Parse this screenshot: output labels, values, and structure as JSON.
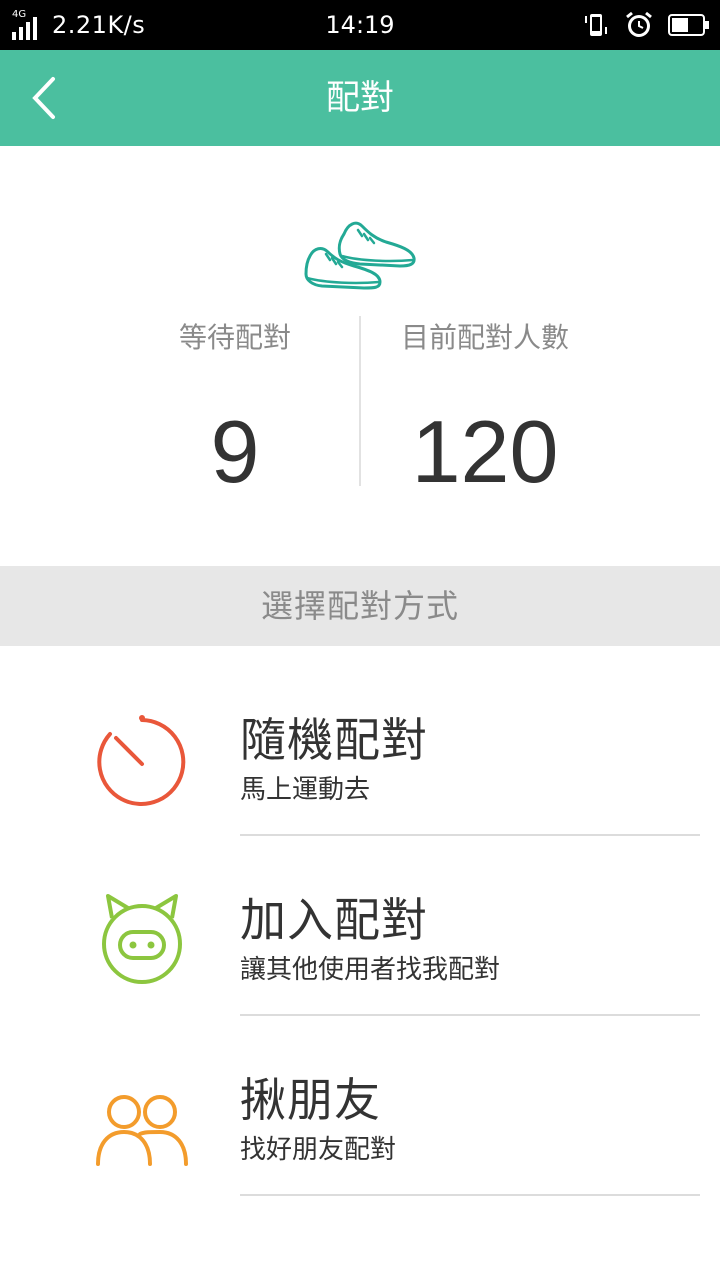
{
  "status_bar": {
    "network_type": "4G",
    "speed": "2.21K/s",
    "time": "14:19",
    "icons": [
      "vibrate-icon",
      "alarm-icon",
      "battery-icon"
    ]
  },
  "header": {
    "title": "配對",
    "back_icon": "chevron-left-icon",
    "background_color": "#4bbf9f"
  },
  "stats": {
    "icon": "shoes-icon",
    "waiting": {
      "label": "等待配對",
      "value": "9"
    },
    "current": {
      "label": "目前配對人數",
      "value": "120"
    }
  },
  "section": {
    "title": "選擇配對方式"
  },
  "options": [
    {
      "title": "隨機配對",
      "subtitle": "馬上運動去",
      "icon": "timer-icon",
      "color": "#e9573a"
    },
    {
      "title": "加入配對",
      "subtitle": "讓其他使用者找我配對",
      "icon": "pig-face-icon",
      "color": "#8cc63f"
    },
    {
      "title": "揪朋友",
      "subtitle": "找好朋友配對",
      "icon": "friends-icon",
      "color": "#f39c2c"
    }
  ]
}
